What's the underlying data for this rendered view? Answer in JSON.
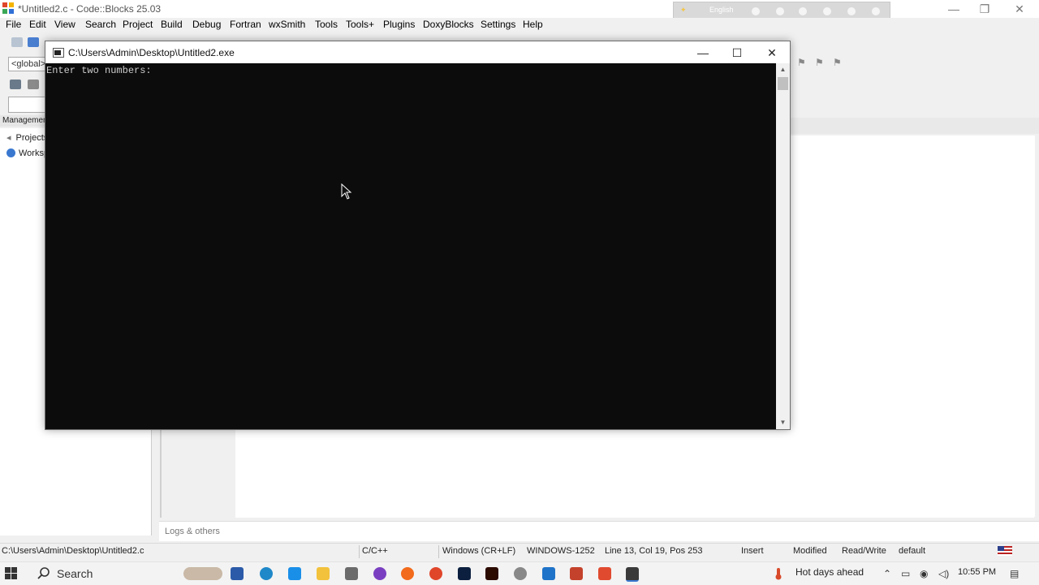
{
  "ide": {
    "title": "*Untitled2.c - Code::Blocks 25.03",
    "menu": [
      "File",
      "Edit",
      "View",
      "Search",
      "Project",
      "Build",
      "Debug",
      "Fortran",
      "wxSmith",
      "Tools",
      "Tools+",
      "Plugins",
      "DoxyBlocks",
      "Settings",
      "Help"
    ],
    "scope_placeholder": "<global>",
    "language_bar_label": "English",
    "management_title": "Management",
    "projects_tab": "Projects",
    "workspace_item": "Workspace",
    "logs_label": "Logs & others"
  },
  "console": {
    "title": "C:\\Users\\Admin\\Desktop\\Untitled2.exe",
    "output": "Enter two numbers:"
  },
  "status": {
    "file_path": "C:\\Users\\Admin\\Desktop\\Untitled2.c",
    "language": "C/C++",
    "line_endings": "Windows (CR+LF)",
    "encoding": "WINDOWS-1252",
    "position": "Line 13, Col 19, Pos 253",
    "insert_mode": "Insert",
    "modified": "Modified",
    "access": "Read/Write",
    "profile": "default"
  },
  "taskbar": {
    "search_label": "Search",
    "weather": "Hot days ahead",
    "time": "10:55 PM"
  },
  "colors": {
    "console_bg": "#0c0c0c",
    "console_text": "#cccccc",
    "accent": "#3a78d0"
  }
}
